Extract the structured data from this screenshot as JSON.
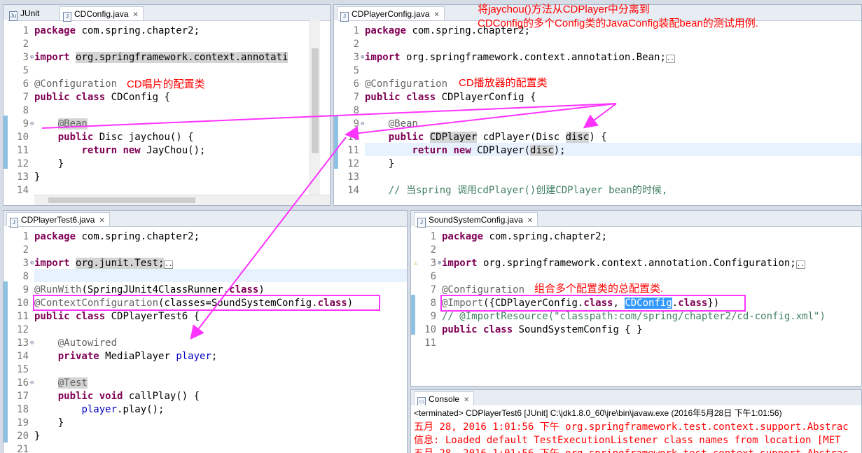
{
  "annotations": {
    "top_note_line1": "将jaychou()方法从CDPlayer中分离到",
    "top_note_line2": "CDConfig的多个Config类的JavaConfig装配bean的测试用例.",
    "cdconfig_note": "CD唱片的配置类",
    "cdplayerconfig_note": "CD播放器的配置类",
    "soundsystem_note": "组合多个配置类的总配置类."
  },
  "pane_cdconfig": {
    "tab_junit": "JUnit",
    "tab_active": "CDConfig.java",
    "lines": [
      {
        "n": "1",
        "t": "package com.spring.chapter2;"
      },
      {
        "n": "2",
        "t": ""
      },
      {
        "n": "3",
        "t": "import org.springframework.context.annotati"
      },
      {
        "n": "5",
        "t": ""
      },
      {
        "n": "6",
        "t": "@Configuration"
      },
      {
        "n": "7",
        "t": "public class CDConfig {"
      },
      {
        "n": "8",
        "t": ""
      },
      {
        "n": "9",
        "t": "    @Bean"
      },
      {
        "n": "10",
        "t": "    public Disc jaychou() {"
      },
      {
        "n": "11",
        "t": "        return new JayChou();"
      },
      {
        "n": "12",
        "t": "    }"
      },
      {
        "n": "13",
        "t": "}"
      },
      {
        "n": "14",
        "t": ""
      }
    ]
  },
  "pane_cdplayerconfig": {
    "tab_active": "CDPlayerConfig.java",
    "lines": [
      {
        "n": "1",
        "t": "package com.spring.chapter2;"
      },
      {
        "n": "2",
        "t": ""
      },
      {
        "n": "3",
        "t": "import org.springframework.context.annotation.Bean;"
      },
      {
        "n": "5",
        "t": ""
      },
      {
        "n": "6",
        "t": "@Configuration"
      },
      {
        "n": "7",
        "t": "public class CDPlayerConfig {"
      },
      {
        "n": "8",
        "t": ""
      },
      {
        "n": "9",
        "t": "    @Bean"
      },
      {
        "n": "10",
        "t": "    public CDPlayer cdPlayer(Disc disc) {"
      },
      {
        "n": "11",
        "t": "        return new CDPlayer(disc);"
      },
      {
        "n": "12",
        "t": "    }"
      },
      {
        "n": "13",
        "t": ""
      },
      {
        "n": "14",
        "t": "    // 当spring 调用cdPlayer()创建CDPlayer bean的时候,"
      }
    ]
  },
  "pane_test": {
    "tab_active": "CDPlayerTest6.java",
    "lines": [
      {
        "n": "1",
        "t": "package com.spring.chapter2;"
      },
      {
        "n": "2",
        "t": ""
      },
      {
        "n": "3",
        "t": "import org.junit.Test;"
      },
      {
        "n": "8",
        "t": ""
      },
      {
        "n": "9",
        "t": "@RunWith(SpringJUnit4ClassRunner.class)"
      },
      {
        "n": "10",
        "t": "@ContextConfiguration(classes=SoundSystemConfig.class)"
      },
      {
        "n": "11",
        "t": "public class CDPlayerTest6 {"
      },
      {
        "n": "12",
        "t": ""
      },
      {
        "n": "13",
        "t": "    @Autowired"
      },
      {
        "n": "14",
        "t": "    private MediaPlayer player;"
      },
      {
        "n": "15",
        "t": ""
      },
      {
        "n": "16",
        "t": "    @Test"
      },
      {
        "n": "17",
        "t": "    public void callPlay() {"
      },
      {
        "n": "18",
        "t": "        player.play();"
      },
      {
        "n": "19",
        "t": "    }"
      },
      {
        "n": "20",
        "t": "}"
      },
      {
        "n": "21",
        "t": ""
      }
    ]
  },
  "pane_soundsystem": {
    "tab_active": "SoundSystemConfig.java",
    "lines": [
      {
        "n": "1",
        "t": "package com.spring.chapter2;"
      },
      {
        "n": "2",
        "t": ""
      },
      {
        "n": "3",
        "t": "import org.springframework.context.annotation.Configuration;"
      },
      {
        "n": "6",
        "t": ""
      },
      {
        "n": "7",
        "t": "@Configuration"
      },
      {
        "n": "8",
        "t": "@Import({CDPlayerConfig.class, CDConfig.class})"
      },
      {
        "n": "9",
        "t": "// @ImportResource(\"classpath:com/spring/chapter2/cd-config.xml\")"
      },
      {
        "n": "10",
        "t": "public class SoundSystemConfig { }"
      },
      {
        "n": "11",
        "t": ""
      }
    ]
  },
  "console": {
    "tab": "Console",
    "header": "<terminated> CDPlayerTest6 [JUnit] C:\\jdk1.8.0_60\\jre\\bin\\javaw.exe (2016年5月28日 下午1:01:56)",
    "lines": [
      "五月 28, 2016 1:01:56 下午 org.springframework.test.context.support.Abstrac",
      "信息: Loaded default TestExecutionListener class names from location [MET",
      "五月 28, 2016 1:01:56 下午 org.springframework.test.context.support.Abstrac"
    ]
  },
  "colors": {
    "keyword": "#7f0055",
    "annotation": "#646464",
    "arrow": "#ff33ff",
    "note": "#ff0000"
  }
}
